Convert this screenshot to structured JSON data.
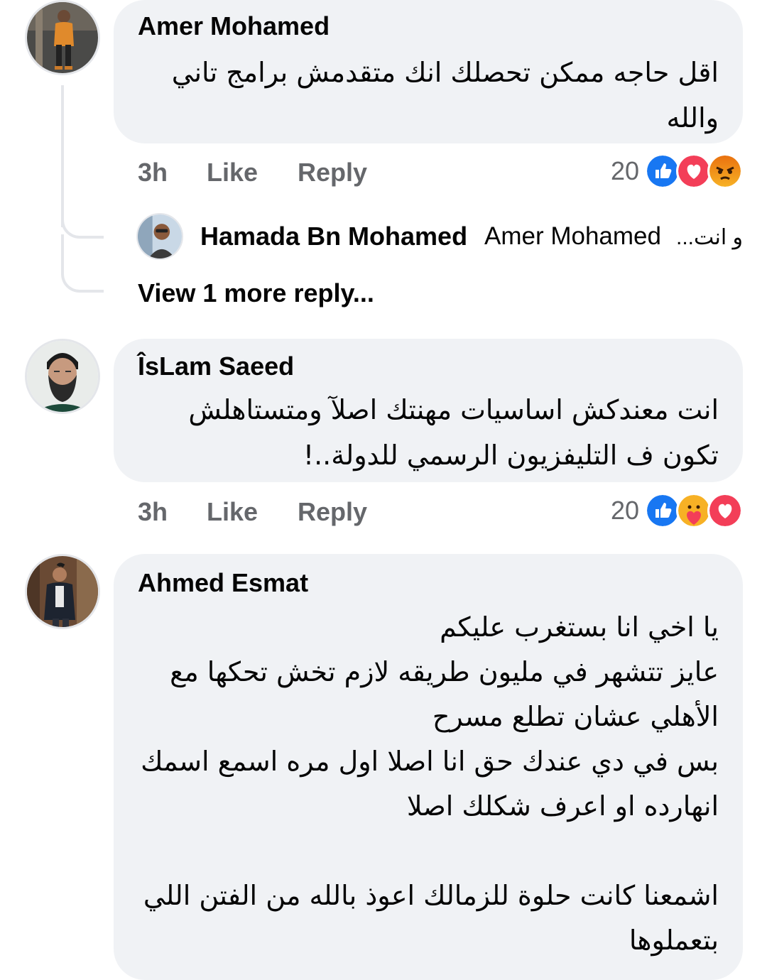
{
  "comments": [
    {
      "author": "Amer Mohamed",
      "text": "اقل حاجه ممكن تحصلك انك متقدمش برامج تاني\nوالله",
      "time": "3h",
      "like_label": "Like",
      "reply_label": "Reply",
      "reaction_count": "20",
      "reactions": [
        "like-icon",
        "love-icon",
        "angry-icon"
      ]
    },
    {
      "author": "ÎsLam Saeed",
      "text": "انت معندكش اساسيات مهنتك اصلآ ومتستاهلش\nتكون ف التليفزيون الرسمي للدولة..!",
      "time": "3h",
      "like_label": "Like",
      "reply_label": "Reply",
      "reaction_count": "20",
      "reactions": [
        "like-icon",
        "care-icon",
        "love-icon"
      ]
    },
    {
      "author": "Ahmed Esmat",
      "text": "يا اخي انا بستغرب عليكم\nعايز تتشهر في مليون طريقه لازم تخش تحكها مع\nالأهلي عشان تطلع مسرح\nبس في دي عندك حق انا اصلا اول مره اسمع اسمك\nانهارده او اعرف شكلك اصلا\n\nاشمعنا كانت حلوة للزمالك اعوذ بالله من الفتن اللي\nبتعملوها"
    }
  ],
  "reply": {
    "author": "Hamada Bn Mohamed",
    "mention": "Amer Mohamed",
    "snippet": "و انت..."
  },
  "view_more_label": "View 1 more reply...",
  "colors": {
    "bubble": "#f0f2f5",
    "secondary_text": "#65676b",
    "like_blue": "#1877f2",
    "love_red": "#f33e58",
    "angry_orange": "#e9710f"
  }
}
